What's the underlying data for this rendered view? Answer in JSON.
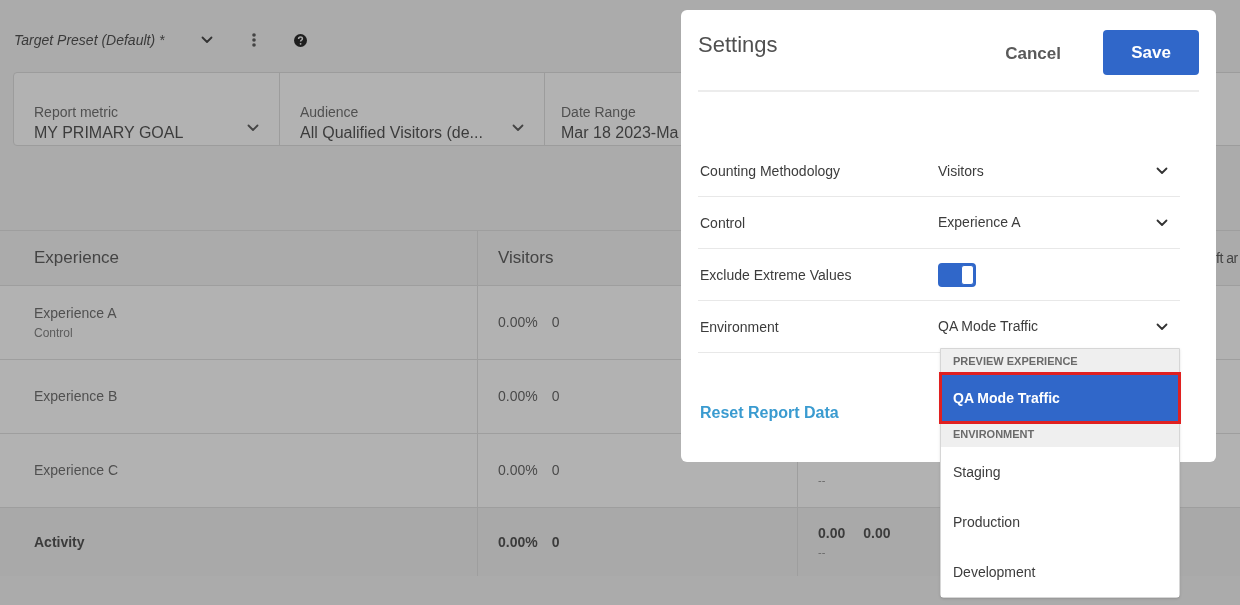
{
  "toolbar": {
    "preset": "Target Preset (Default) *"
  },
  "filters": [
    {
      "label": "Report metric",
      "value": "MY PRIMARY GOAL"
    },
    {
      "label": "Audience",
      "value": "All Qualified Visitors (de..."
    },
    {
      "label": "Date Range",
      "value": "Mar 18 2023-Ma"
    }
  ],
  "table": {
    "column_1": "Experience",
    "column_2": "Visitors",
    "column_4": "ft ar",
    "rows": [
      {
        "kind": "experience",
        "name": "Experience A",
        "subtitle": "Control",
        "rate": "0.00%",
        "count": "0"
      },
      {
        "kind": "experience",
        "name": "Experience B",
        "rate": "0.00%",
        "count": "0"
      },
      {
        "kind": "experience",
        "name": "Experience C",
        "rate": "0.00%",
        "count": "0",
        "col3_sub": "--"
      },
      {
        "kind": "total",
        "name": "Activity",
        "rate": "0.00%",
        "count": "0",
        "col3": [
          "0.00",
          "0.00"
        ],
        "col3_sub": "--"
      }
    ]
  },
  "dialog": {
    "title": "Settings",
    "cancel": "Cancel",
    "save": "Save",
    "settings": [
      {
        "kind": "dropdown",
        "label": "Counting Methodology",
        "value": "Visitors"
      },
      {
        "kind": "dropdown",
        "label": "Control",
        "value": "Experience A"
      },
      {
        "kind": "toggle",
        "label": "Exclude Extreme Values",
        "on": true
      },
      {
        "kind": "dropdown",
        "label": "Environment",
        "value": "QA Mode Traffic"
      }
    ],
    "reset_link": "Reset Report Data"
  },
  "menu": {
    "sections": [
      {
        "header": "PREVIEW EXPERIENCE",
        "items": [
          {
            "label": "QA Mode Traffic",
            "selected": true,
            "outlined": true
          }
        ]
      },
      {
        "header": "ENVIRONMENT",
        "items": [
          {
            "label": "Staging",
            "selected": false,
            "outlined": false
          },
          {
            "label": "Production",
            "selected": false,
            "outlined": false
          },
          {
            "label": "Development",
            "selected": false,
            "outlined": false
          }
        ]
      }
    ]
  }
}
